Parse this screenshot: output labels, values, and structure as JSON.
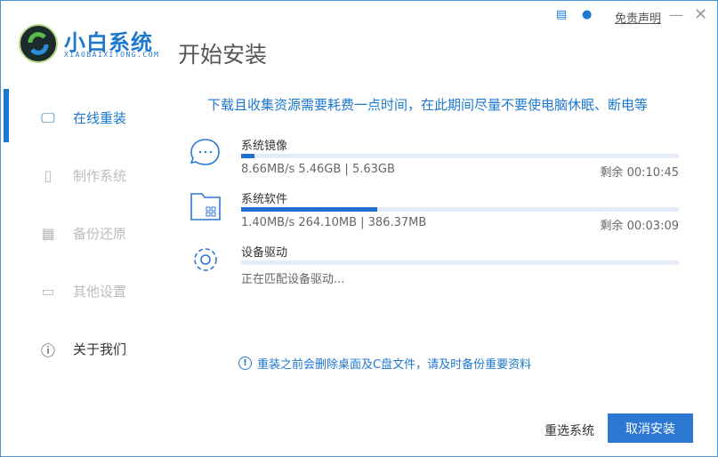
{
  "app": {
    "brand": "小白系统",
    "brand_sub": "XIAOBAIXITONG.COM",
    "title": "开始安装",
    "accent": "#1e78d0"
  },
  "titlebar": {
    "disclaimer": "免责声明",
    "minimize": "—",
    "close": "✕"
  },
  "sidebar": {
    "items": [
      {
        "label": "在线重装",
        "icon": "monitor-icon",
        "active": true
      },
      {
        "label": "制作系统",
        "icon": "usb-icon"
      },
      {
        "label": "备份还原",
        "icon": "backup-icon"
      },
      {
        "label": "其他设置",
        "icon": "briefcase-icon"
      },
      {
        "label": "关于我们",
        "icon": "info-icon"
      }
    ]
  },
  "main": {
    "notice": "下载且收集资源需要耗费一点时间，在此期间尽量不要使电脑休眠、断电等",
    "tasks": [
      {
        "name": "系统镜像",
        "progress": 3,
        "stat": "8.66MB/s 5.46GB | 5.63GB",
        "remain": "剩余 00:10:45",
        "icon": "chat-bubble-icon"
      },
      {
        "name": "系统软件",
        "progress": 31,
        "stat": "1.40MB/s 264.10MB | 386.37MB",
        "remain": "剩余 00:03:09",
        "icon": "folder-icon"
      },
      {
        "name": "设备驱动",
        "progress": 0,
        "stat": "正在匹配设备驱动...",
        "remain": "",
        "icon": "gear-icon"
      }
    ],
    "warning": "重装之前会删除桌面及C盘文件，请及时备份重要资料"
  },
  "footer": {
    "reselect": "重选系统",
    "cancel": "取消安装"
  }
}
